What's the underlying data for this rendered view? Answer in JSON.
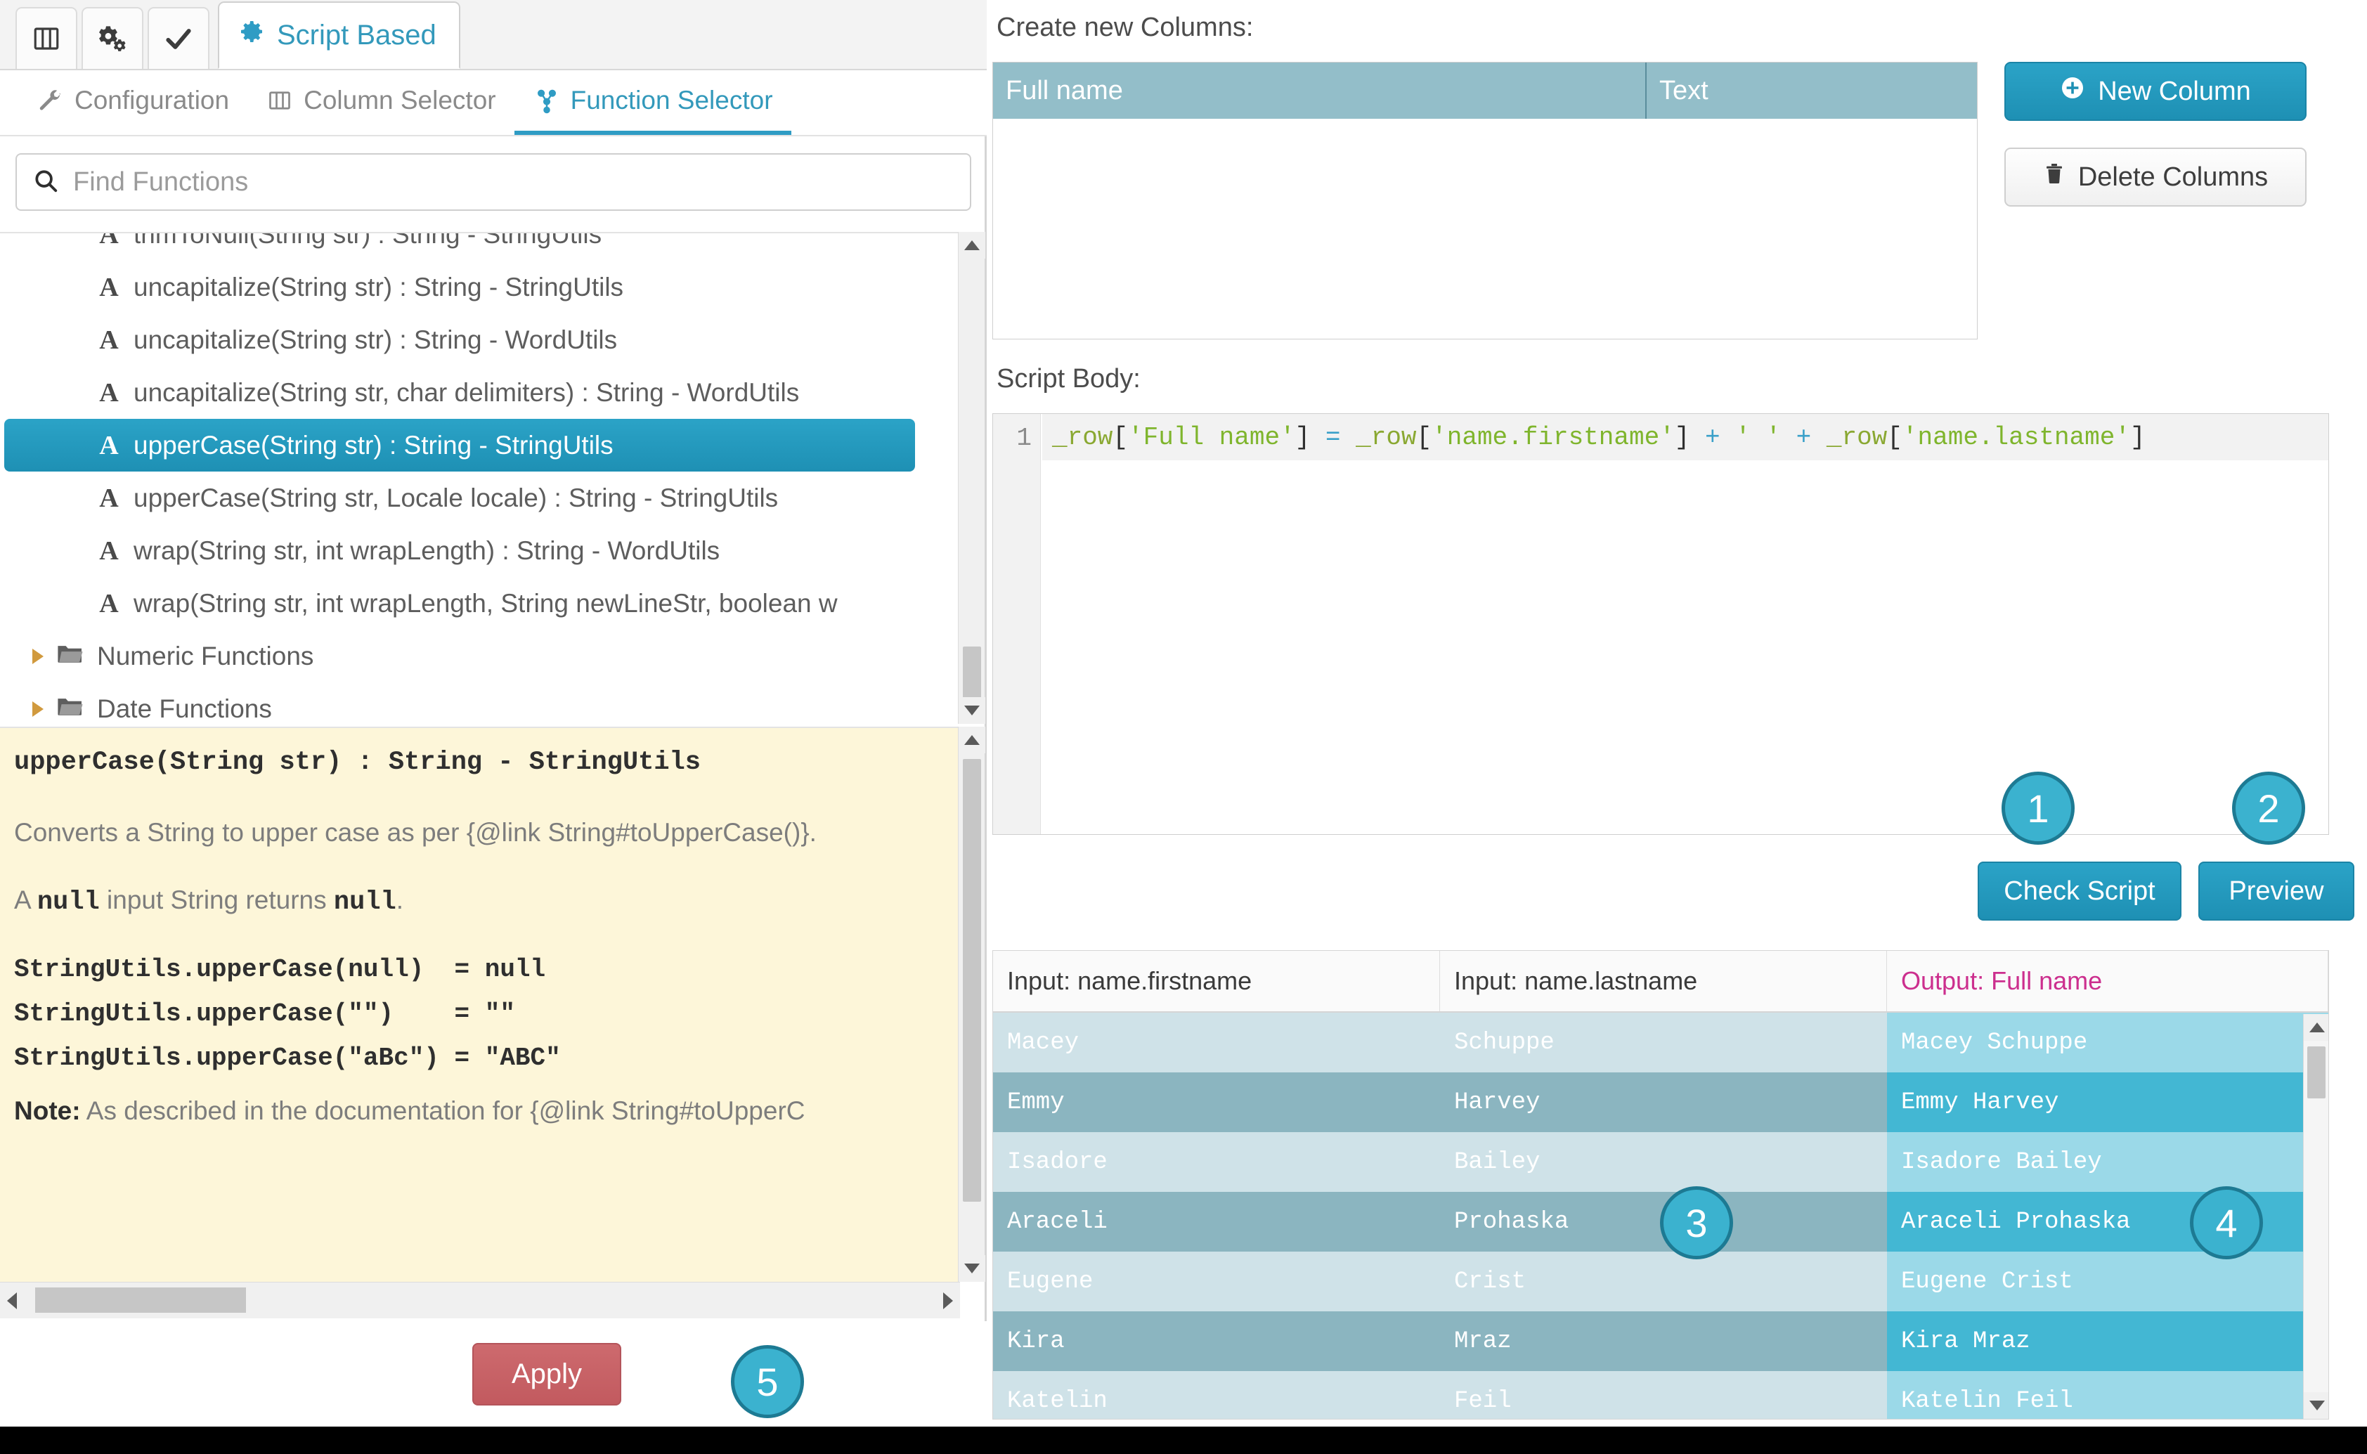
{
  "window_tabs": {
    "icon_tabs": [
      {
        "name": "layout-columns-icon"
      },
      {
        "name": "gears-icon"
      },
      {
        "name": "check-icon"
      }
    ],
    "active_tab": {
      "icon": "gear-icon",
      "label": "Script Based"
    }
  },
  "subtabs": [
    {
      "icon": "wrench-icon",
      "label": "Configuration",
      "active": false
    },
    {
      "icon": "columns-icon",
      "label": "Column Selector",
      "active": false
    },
    {
      "icon": "nodes-icon",
      "label": "Function Selector",
      "active": true
    }
  ],
  "search": {
    "icon": "search-icon",
    "placeholder": "Find Functions",
    "value": ""
  },
  "function_tree": {
    "items": [
      {
        "label": "trimToNull(String str) : String - StringUtils",
        "selected": false,
        "clipped": true
      },
      {
        "label": "uncapitalize(String str) : String - StringUtils",
        "selected": false
      },
      {
        "label": "uncapitalize(String str) : String - WordUtils",
        "selected": false
      },
      {
        "label": "uncapitalize(String str, char delimiters) : String - WordUtils",
        "selected": false
      },
      {
        "label": "upperCase(String str) : String - StringUtils",
        "selected": true
      },
      {
        "label": "upperCase(String str, Locale locale) : String - StringUtils",
        "selected": false
      },
      {
        "label": "wrap(String str, int wrapLength) : String - WordUtils",
        "selected": false
      },
      {
        "label": "wrap(String str, int wrapLength, String newLineStr, boolean w",
        "selected": false
      }
    ],
    "folders": [
      {
        "label": "Numeric Functions",
        "icon": "folder-icon",
        "expanded": false
      },
      {
        "label": "Date Functions",
        "icon": "folder-icon",
        "expanded": false
      }
    ]
  },
  "documentation": {
    "title": "upperCase(String str) : String - StringUtils",
    "paragraph_1": "Converts a String to upper case as per {@link String#toUpperCase()}.",
    "paragraph_2_pre": "A ",
    "paragraph_2_mono1": "null",
    "paragraph_2_mid": " input String returns ",
    "paragraph_2_mono2": "null",
    "paragraph_2_post": ".",
    "code_lines": [
      "StringUtils.upperCase(null)  = null",
      "StringUtils.upperCase(\"\")    = \"\"",
      "StringUtils.upperCase(\"aBc\") = \"ABC\""
    ],
    "note_label": "Note:",
    "note_text": " As described in the documentation for {@link String#toUpperC"
  },
  "apply": {
    "label": "Apply"
  },
  "right": {
    "create_columns_label": "Create new Columns:",
    "new_columns_table": {
      "headers": [
        "Full name",
        "Text"
      ],
      "rows": []
    },
    "buttons": {
      "new_column": {
        "label": "New Column",
        "icon": "plus-circle-icon"
      },
      "delete_columns": {
        "label": "Delete Columns",
        "icon": "trash-icon"
      }
    },
    "script_body_label": "Script Body:",
    "editor": {
      "line_number": "1",
      "tokens": [
        {
          "t": "_row",
          "c": "var"
        },
        {
          "t": "[",
          "c": "pl"
        },
        {
          "t": "'Full name'",
          "c": "str"
        },
        {
          "t": "]",
          "c": "pl"
        },
        {
          "t": " ",
          "c": "pl"
        },
        {
          "t": "=",
          "c": "op"
        },
        {
          "t": " ",
          "c": "pl"
        },
        {
          "t": "_row",
          "c": "var"
        },
        {
          "t": "[",
          "c": "pl"
        },
        {
          "t": "'name.firstname'",
          "c": "str"
        },
        {
          "t": "]",
          "c": "pl"
        },
        {
          "t": " ",
          "c": "pl"
        },
        {
          "t": "+",
          "c": "op"
        },
        {
          "t": " ",
          "c": "pl"
        },
        {
          "t": "' '",
          "c": "str"
        },
        {
          "t": " ",
          "c": "pl"
        },
        {
          "t": "+",
          "c": "op"
        },
        {
          "t": " ",
          "c": "pl"
        },
        {
          "t": "_row",
          "c": "var"
        },
        {
          "t": "[",
          "c": "pl"
        },
        {
          "t": "'name.lastname'",
          "c": "str"
        },
        {
          "t": "]",
          "c": "pl"
        }
      ],
      "plain_text": "_row['Full name'] = _row['name.firstname'] + ' ' + _row['name.lastname']"
    },
    "action_buttons": {
      "check_script": "Check Script",
      "preview": "Preview"
    },
    "preview_table": {
      "headers": [
        "Input: name.firstname",
        "Input: name.lastname",
        "Output: Full name"
      ],
      "rows": [
        [
          "Macey",
          "Schuppe",
          "Macey Schuppe"
        ],
        [
          "Emmy",
          "Harvey",
          "Emmy Harvey"
        ],
        [
          "Isadore",
          "Bailey",
          "Isadore Bailey"
        ],
        [
          "Araceli",
          "Prohaska",
          "Araceli Prohaska"
        ],
        [
          "Eugene",
          "Crist",
          "Eugene Crist"
        ],
        [
          "Kira",
          "Mraz",
          "Kira Mraz"
        ],
        [
          "Katelin",
          "Feil",
          "Katelin Feil"
        ]
      ]
    }
  },
  "badges": [
    {
      "id": "1",
      "label": "1"
    },
    {
      "id": "2",
      "label": "2"
    },
    {
      "id": "3",
      "label": "3"
    },
    {
      "id": "4",
      "label": "4"
    },
    {
      "id": "5",
      "label": "5"
    }
  ],
  "colors": {
    "accent": "#2ba3c7",
    "badge_fill": "#3bb2cf",
    "badge_border": "#1d7a93",
    "header_teal": "#93bec9",
    "output_header": "#cc2f8e",
    "apply_red": "#c25a5f",
    "doc_bg": "#fdf6d9"
  }
}
